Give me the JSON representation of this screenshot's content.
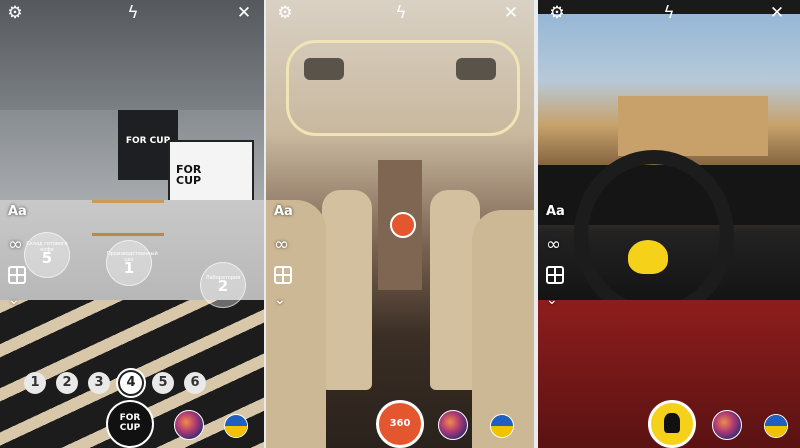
{
  "panels": [
    {
      "brand_label": "FOR CUP",
      "screen_text": "FOR CUP",
      "hotspots": [
        {
          "label": "Склад готового кофе",
          "number": "5"
        },
        {
          "label": "Производственный цех",
          "number": "1"
        },
        {
          "label": "Лаборатория",
          "number": "2"
        }
      ],
      "scene_numbers": [
        "1",
        "2",
        "3",
        "4",
        "5",
        "6"
      ],
      "active_scene": "4",
      "text_button": "Aa",
      "infinity_symbol": "∞",
      "logo_text": "FOR CUP"
    },
    {
      "text_button": "Aa",
      "infinity_symbol": "∞",
      "center_button": "360"
    },
    {
      "text_button": "Aa",
      "infinity_symbol": "∞"
    }
  ],
  "icons": {
    "settings": "⚙",
    "flash_off": "ϟ",
    "close": "✕",
    "chevron": "⌄"
  },
  "colors": {
    "accent_orange": "#e4572e",
    "ferrari_yellow": "#f6d11a",
    "ukraine_blue": "#1f5fbf",
    "ukraine_yellow": "#f2c200"
  }
}
